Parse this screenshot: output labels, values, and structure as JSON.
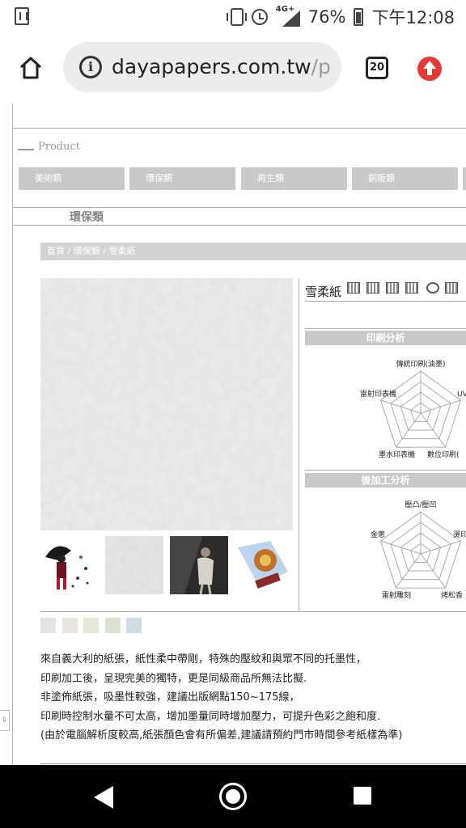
{
  "status_bar": {
    "network": "4G+",
    "battery": "76%",
    "time": "下午12:08",
    "icons": [
      "screenshot-icon",
      "vibrate-icon",
      "alarm-icon",
      "signal-icon",
      "battery-icon"
    ]
  },
  "browser": {
    "url_domain": "dayapapers.com.tw",
    "url_path": "/pro",
    "tab_count": "20"
  },
  "page": {
    "product_label": "Product",
    "categories": [
      "美術類",
      "環保類",
      "再生類",
      "銅版類"
    ],
    "section_title": "環保類",
    "breadcrumb": "首頁 / 環保類 / 雪柔紙",
    "product_name": "雪柔紙",
    "print_analysis": {
      "title": "印刷分析",
      "axes": [
        "傳統印刷(油墨)",
        "UV",
        "數位印刷(",
        "墨水印表機",
        "雷射印表機"
      ]
    },
    "post_analysis": {
      "title": "後加工分析",
      "axes": [
        "壓凸/壓凹",
        "燙印",
        "烤松香",
        "雷射雕刻",
        "金蔥"
      ]
    },
    "swatch_colors": [
      "#e3e5e3",
      "#e7e5dd",
      "#e3e9d6",
      "#d8e4cf",
      "#cfdde3"
    ],
    "description": [
      "來自義大利的紙張，紙性柔中帶剛，特殊的壓紋和與眾不同的托墨性，",
      "印刷加工後，呈現完美的獨特，更是同級商品所無法比擬.",
      "非塗佈紙張，吸墨性較強，建議出版網點150~175線，",
      "印刷時控制水量不可太高，增加墨量同時增加壓力，可提升色彩之飽和度.",
      "(由於電腦解析度較高,紙張顏色會有所偏差,建議請預約門市時間參考紙樣為準)"
    ]
  },
  "colors": {
    "gray_bar": "#c9c9c9",
    "upgrade_red": "#e53935"
  }
}
